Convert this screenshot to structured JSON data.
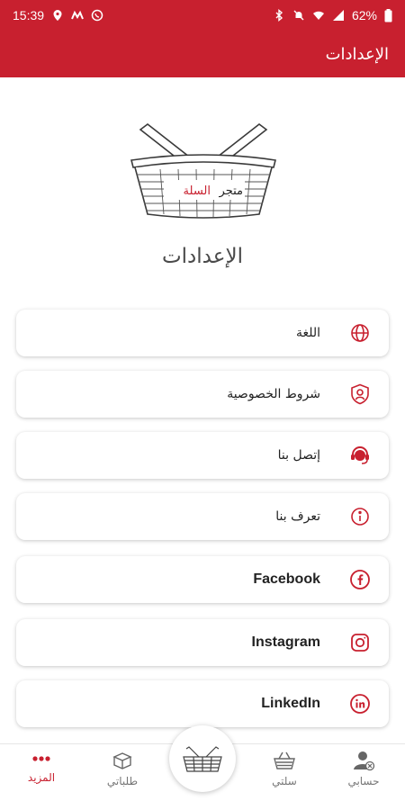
{
  "status_bar": {
    "time": "15:39",
    "battery": "62%"
  },
  "app_bar": {
    "title": "الإعدادات"
  },
  "logo": {
    "text_part1": "متجر",
    "text_part2": "السلة"
  },
  "page": {
    "heading": "الإعدادات"
  },
  "settings": {
    "items": [
      {
        "label": "اللغة",
        "icon": "globe-icon"
      },
      {
        "label": "شروط الخصوصية",
        "icon": "shield-user-icon"
      },
      {
        "label": "إتصل بنا",
        "icon": "headset-icon"
      },
      {
        "label": "تعرف بنا",
        "icon": "info-icon"
      },
      {
        "label": "Facebook",
        "icon": "facebook-icon"
      },
      {
        "label": "Instagram",
        "icon": "instagram-icon"
      },
      {
        "label": "LinkedIn",
        "icon": "linkedin-icon"
      }
    ]
  },
  "bottom_nav": {
    "items": [
      {
        "label": "المزيد",
        "icon": "more-dots-icon",
        "active": true
      },
      {
        "label": "طلباتي",
        "icon": "box-icon",
        "active": false
      },
      {
        "label": "سلتي",
        "icon": "basket-icon",
        "active": false
      },
      {
        "label": "حسابي",
        "icon": "account-icon",
        "active": false
      }
    ]
  },
  "colors": {
    "brand": "#c8202f",
    "text": "#222222"
  }
}
